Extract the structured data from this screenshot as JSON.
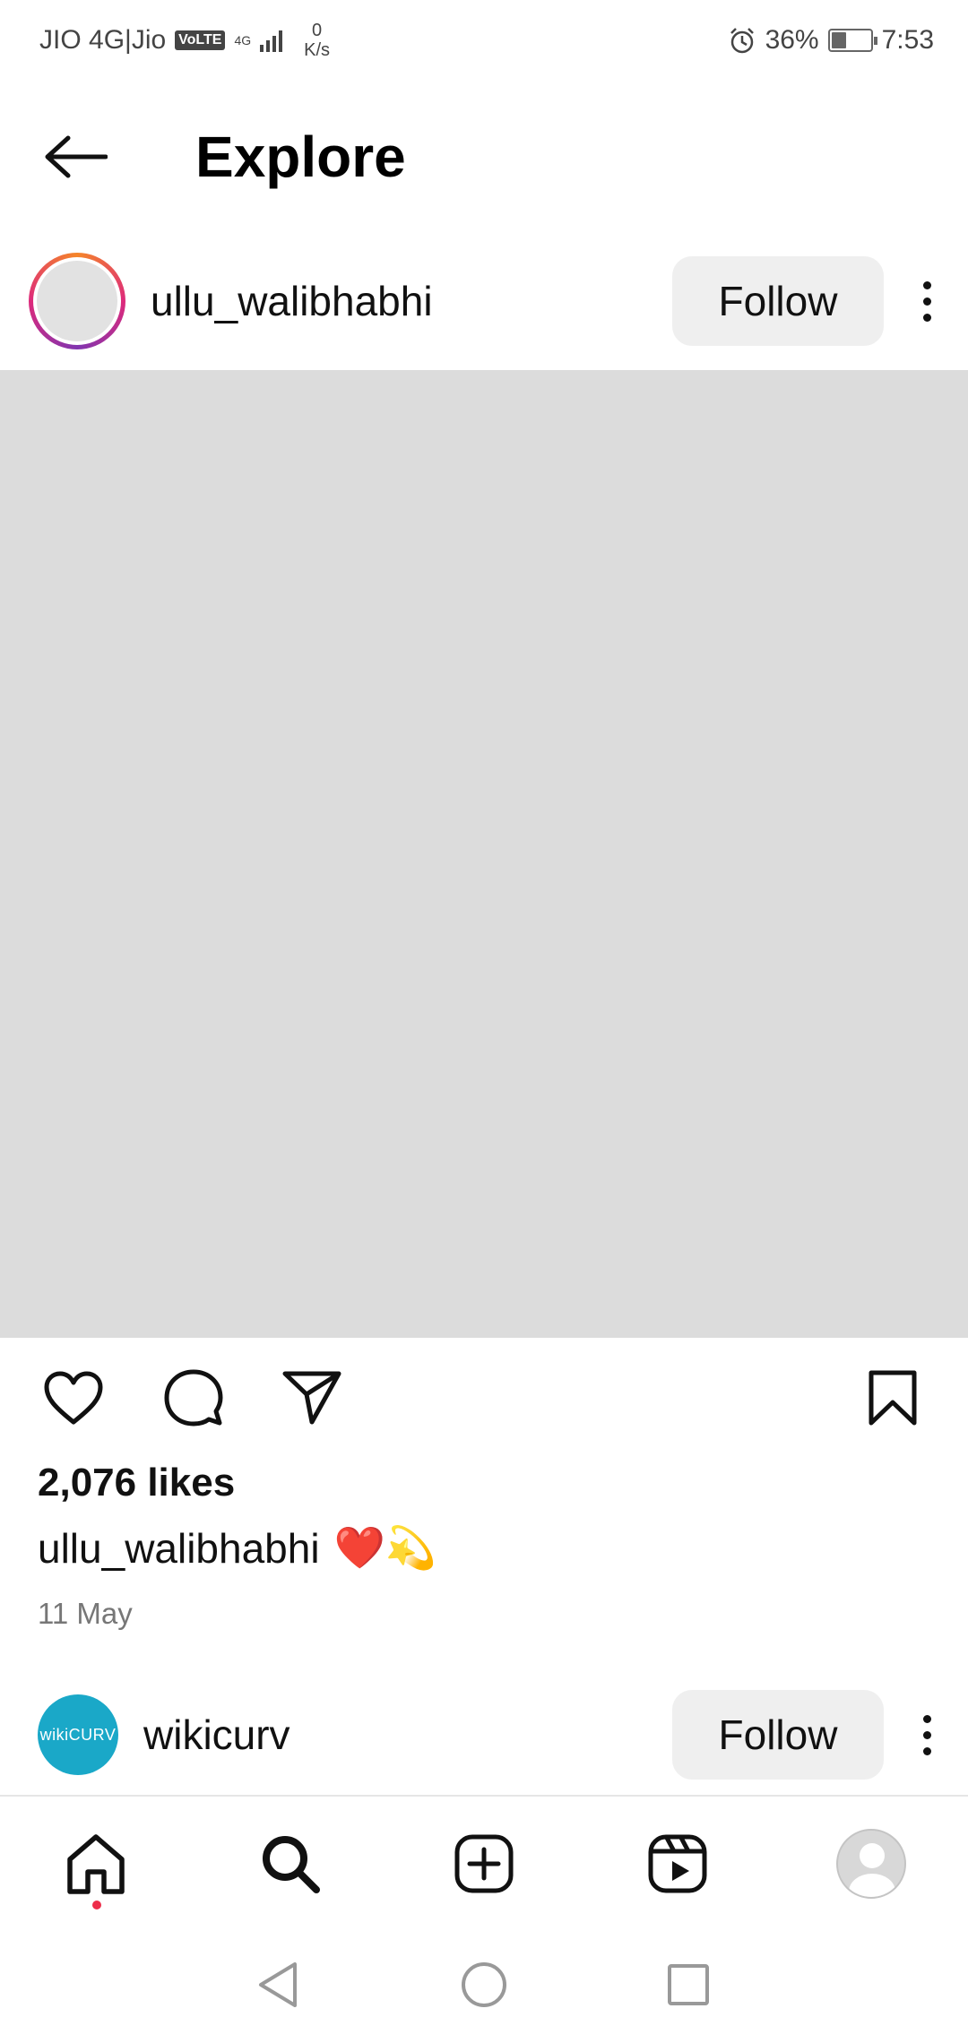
{
  "status": {
    "carrier": "JIO 4G|Jio",
    "volte": "VoLTE",
    "network_type": "4G",
    "speed_value": "0",
    "speed_unit": "K/s",
    "battery": "36%",
    "battery_level": 0.36,
    "time": "7:53"
  },
  "header": {
    "title": "Explore"
  },
  "post": {
    "username": "ullu_walibhabhi",
    "follow_label": "Follow",
    "likes": "2,076 likes",
    "caption_user": "ullu_walibhabhi",
    "caption_emoji": "❤️💫",
    "date": "11 May"
  },
  "next_post": {
    "username": "wikicurv",
    "avatar_text": "wikiCURV",
    "follow_label": "Follow"
  },
  "icons": {
    "back": "arrow-left-icon",
    "like": "heart-icon",
    "comment": "comment-bubble-icon",
    "share": "paper-plane-icon",
    "save": "bookmark-icon",
    "more": "more-vertical-icon"
  },
  "nav": [
    "home-icon",
    "search-icon",
    "add-post-icon",
    "reels-icon",
    "profile-avatar"
  ],
  "colors": {
    "notification_dot": "#ed2d4a",
    "follow_bg": "#efefef",
    "story_ring": "#dd2a7b"
  }
}
